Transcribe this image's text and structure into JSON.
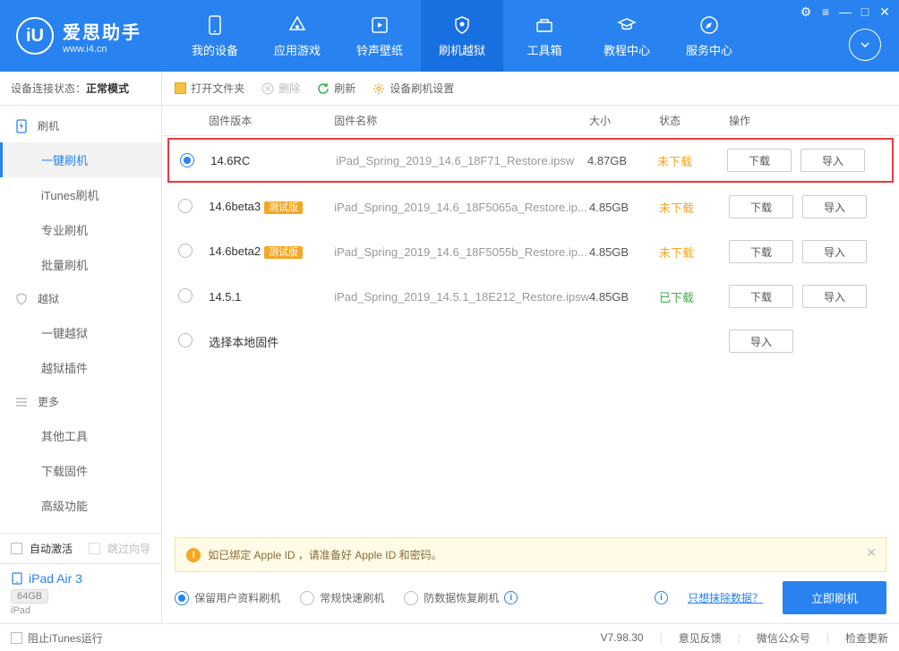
{
  "window_controls": {
    "settings": "⚙",
    "menu": "≡",
    "min": "—",
    "max": "□",
    "close": "✕"
  },
  "logo": {
    "title": "爱思助手",
    "sub": "www.i4.cn",
    "mark": "iU"
  },
  "nav": [
    {
      "label": "我的设备",
      "icon": "device"
    },
    {
      "label": "应用游戏",
      "icon": "apps"
    },
    {
      "label": "铃声壁纸",
      "icon": "music"
    },
    {
      "label": "刷机越狱",
      "icon": "shield",
      "active": true
    },
    {
      "label": "工具箱",
      "icon": "toolbox"
    },
    {
      "label": "教程中心",
      "icon": "edu"
    },
    {
      "label": "服务中心",
      "icon": "compass"
    }
  ],
  "conn_status": {
    "label": "设备连接状态：",
    "value": "正常模式"
  },
  "sidebar": {
    "groups": [
      {
        "icon": "flash-blue",
        "label": "刷机",
        "subs": [
          {
            "label": "一键刷机",
            "active": true
          },
          {
            "label": "iTunes刷机"
          },
          {
            "label": "专业刷机"
          },
          {
            "label": "批量刷机"
          }
        ]
      },
      {
        "icon": "shield-gray",
        "label": "越狱",
        "subs": [
          {
            "label": "一键越狱"
          },
          {
            "label": "越狱插件"
          }
        ]
      },
      {
        "icon": "menu-gray",
        "label": "更多",
        "subs": [
          {
            "label": "其他工具"
          },
          {
            "label": "下载固件"
          },
          {
            "label": "高级功能"
          }
        ]
      }
    ]
  },
  "side_bottom": {
    "auto_activate": "自动激活",
    "skip_guide": "跳过向导"
  },
  "device": {
    "name": "iPad Air 3",
    "storage": "64GB",
    "type": "iPad"
  },
  "toolbar": {
    "open_folder": "打开文件夹",
    "delete": "删除",
    "refresh": "刷新",
    "settings": "设备刷机设置"
  },
  "table": {
    "headers": {
      "version": "固件版本",
      "name": "固件名称",
      "size": "大小",
      "status": "状态",
      "ops": "操作"
    },
    "rows": [
      {
        "selected": true,
        "version": "14.6RC",
        "tag": "",
        "name": "iPad_Spring_2019_14.6_18F71_Restore.ipsw",
        "size": "4.87GB",
        "status": "未下载",
        "status_type": "wait",
        "download": true,
        "highlight": true
      },
      {
        "selected": false,
        "version": "14.6beta3",
        "tag": "测试版",
        "name": "iPad_Spring_2019_14.6_18F5065a_Restore.ip...",
        "size": "4.85GB",
        "status": "未下载",
        "status_type": "wait",
        "download": true
      },
      {
        "selected": false,
        "version": "14.6beta2",
        "tag": "测试版",
        "name": "iPad_Spring_2019_14.6_18F5055b_Restore.ip...",
        "size": "4.85GB",
        "status": "未下载",
        "status_type": "wait",
        "download": true
      },
      {
        "selected": false,
        "version": "14.5.1",
        "tag": "",
        "name": "iPad_Spring_2019_14.5.1_18E212_Restore.ipsw",
        "size": "4.85GB",
        "status": "已下载",
        "status_type": "done",
        "download": true
      },
      {
        "selected": false,
        "version": "选择本地固件",
        "tag": "",
        "name": "",
        "size": "",
        "status": "",
        "status_type": "",
        "download": false
      }
    ],
    "btn_download": "下载",
    "btn_import": "导入"
  },
  "notice": "如已绑定 Apple ID ，请准备好 Apple ID 和密码。",
  "options": {
    "opt1": "保留用户资料刷机",
    "opt2": "常规快速刷机",
    "opt3": "防数据恢复刷机",
    "link": "只想抹除数据？",
    "primary": "立即刷机"
  },
  "footer": {
    "block_itunes": "阻止iTunes运行",
    "version": "V7.98.30",
    "feedback": "意见反馈",
    "wechat": "微信公众号",
    "update": "检查更新"
  }
}
